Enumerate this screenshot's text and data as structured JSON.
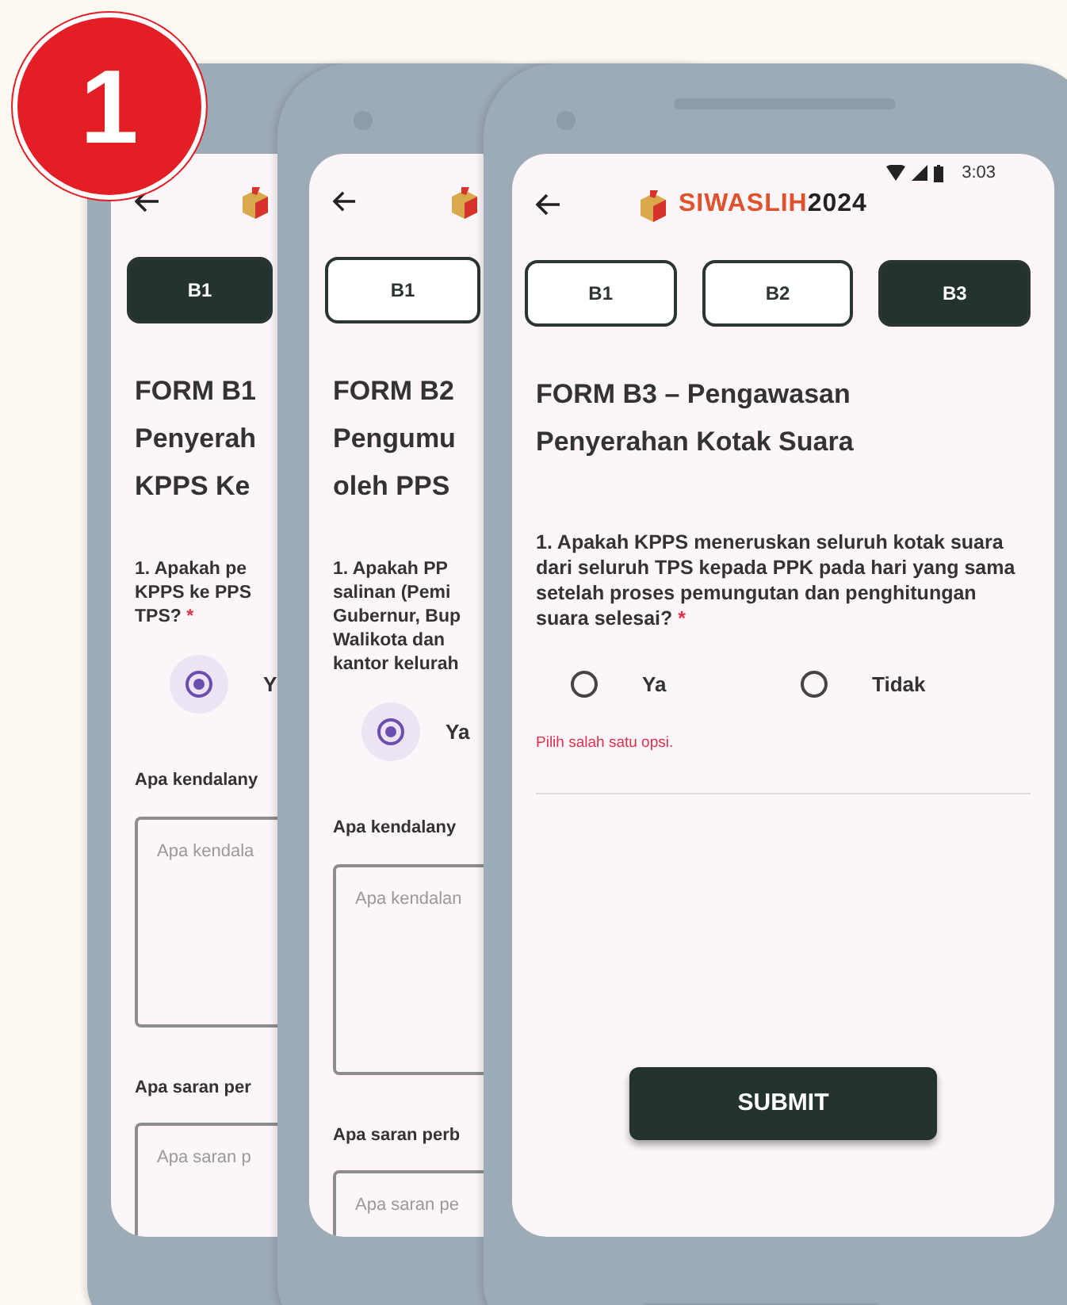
{
  "badge": "1",
  "phones": [
    {
      "kind": "partial",
      "tabs": [
        {
          "label": "B1",
          "selected": true
        }
      ],
      "title_lines": [
        "FORM B1",
        "Penyerah",
        "KPPS Ke"
      ],
      "question_lines": [
        "1. Apakah pe",
        "KPPS ke PPS",
        "TPS?"
      ],
      "required_mark": "*",
      "options": [
        {
          "label": "Y",
          "selected": true
        }
      ],
      "fields": [
        {
          "label": "Apa kendalany",
          "placeholder": "Apa kendala"
        },
        {
          "label": "Apa saran per",
          "placeholder": "Apa saran p"
        }
      ]
    },
    {
      "kind": "partial",
      "tabs": [
        {
          "label": "B1",
          "selected": false
        }
      ],
      "title_lines": [
        "FORM B2",
        "Pengumu",
        "oleh PPS"
      ],
      "question_lines": [
        "1. Apakah PP",
        "salinan (Pemi",
        "Gubernur, Bup",
        "Walikota dan",
        "kantor kelurah"
      ],
      "options": [
        {
          "label": "Ya",
          "selected": true
        }
      ],
      "fields": [
        {
          "label": "Apa kendalany",
          "placeholder": "Apa kendalan"
        },
        {
          "label": "Apa saran perb",
          "placeholder": "Apa saran pe"
        }
      ]
    },
    {
      "kind": "full",
      "time": "3:03",
      "logo": {
        "name": "SIWASLIH",
        "year": "2024"
      },
      "tabs": [
        {
          "label": "B1",
          "selected": false
        },
        {
          "label": "B2",
          "selected": false
        },
        {
          "label": "B3",
          "selected": true
        }
      ],
      "title_lines": [
        "FORM B3 – Pengawasan",
        "Penyerahan Kotak Suara"
      ],
      "question_lines": [
        "1. Apakah KPPS meneruskan seluruh kotak suara dari seluruh TPS kepada PPK pada hari yang sama setelah proses pemungutan dan penghitungan suara selesai?"
      ],
      "required_mark": "*",
      "options": [
        {
          "label": "Ya",
          "selected": false
        },
        {
          "label": "Tidak",
          "selected": false
        }
      ],
      "error": "Pilih salah satu opsi.",
      "submit": "SUBMIT"
    }
  ]
}
